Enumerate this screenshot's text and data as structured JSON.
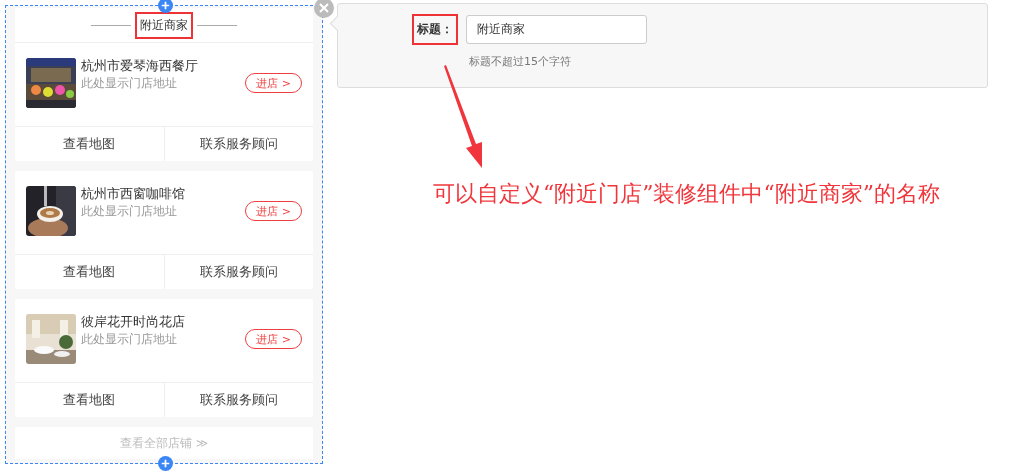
{
  "preview": {
    "title": "附近商家",
    "stores": [
      {
        "name": "杭州市爱琴海西餐厅",
        "address": "此处显示门店地址",
        "enter_label": "进店 >",
        "actions": [
          "查看地图",
          "联系服务顾问"
        ]
      },
      {
        "name": "杭州市西窗咖啡馆",
        "address": "此处显示门店地址",
        "enter_label": "进店 >",
        "actions": [
          "查看地图",
          "联系服务顾问"
        ]
      },
      {
        "name": "彼岸花开时尚花店",
        "address": "此处显示门店地址",
        "enter_label": "进店 >",
        "actions": [
          "查看地图",
          "联系服务顾问"
        ]
      }
    ],
    "footer_link": "查看全部店铺",
    "footer_icon": "≫"
  },
  "settings": {
    "label": "标题：",
    "value": "附近商家",
    "hint": "标题不超过15个字符"
  },
  "annotation": "可以自定义“附近门店”装修组件中“附近商家”的名称"
}
